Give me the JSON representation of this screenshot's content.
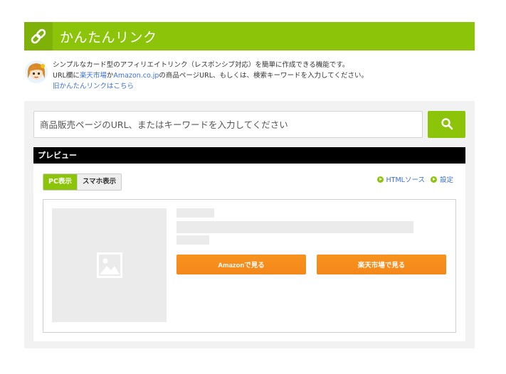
{
  "header": {
    "title": "かんたんリンク",
    "icon": "link-icon"
  },
  "intro": {
    "line1": "シンプルなカード型のアフィリエイトリンク（レスポンシブ対応）を簡単に作成できる機能です。",
    "line2_prefix": "URL欄に",
    "line2_rakuten": "楽天市場",
    "line2_mid": "か",
    "line2_amazon": "Amazon.co.jp",
    "line2_suffix": "の商品ページURL、もしくは、検索キーワードを入力してください。",
    "old_link": "旧かんたんリンクはこちら"
  },
  "search": {
    "placeholder": "商品販売ページのURL、またはキーワードを入力してください",
    "value": ""
  },
  "preview": {
    "title": "プレビュー",
    "tabs": [
      {
        "label": "PC表示",
        "active": true
      },
      {
        "label": "スマホ表示",
        "active": false
      }
    ],
    "tools": {
      "html_source": "HTMLソース",
      "settings": "設定"
    },
    "buttons": {
      "amazon": "Amazonで見る",
      "rakuten": "楽天市場で見る"
    }
  },
  "colors": {
    "accent": "#8cc40a",
    "button_orange": "#f7931e",
    "link": "#3a6fd8"
  }
}
